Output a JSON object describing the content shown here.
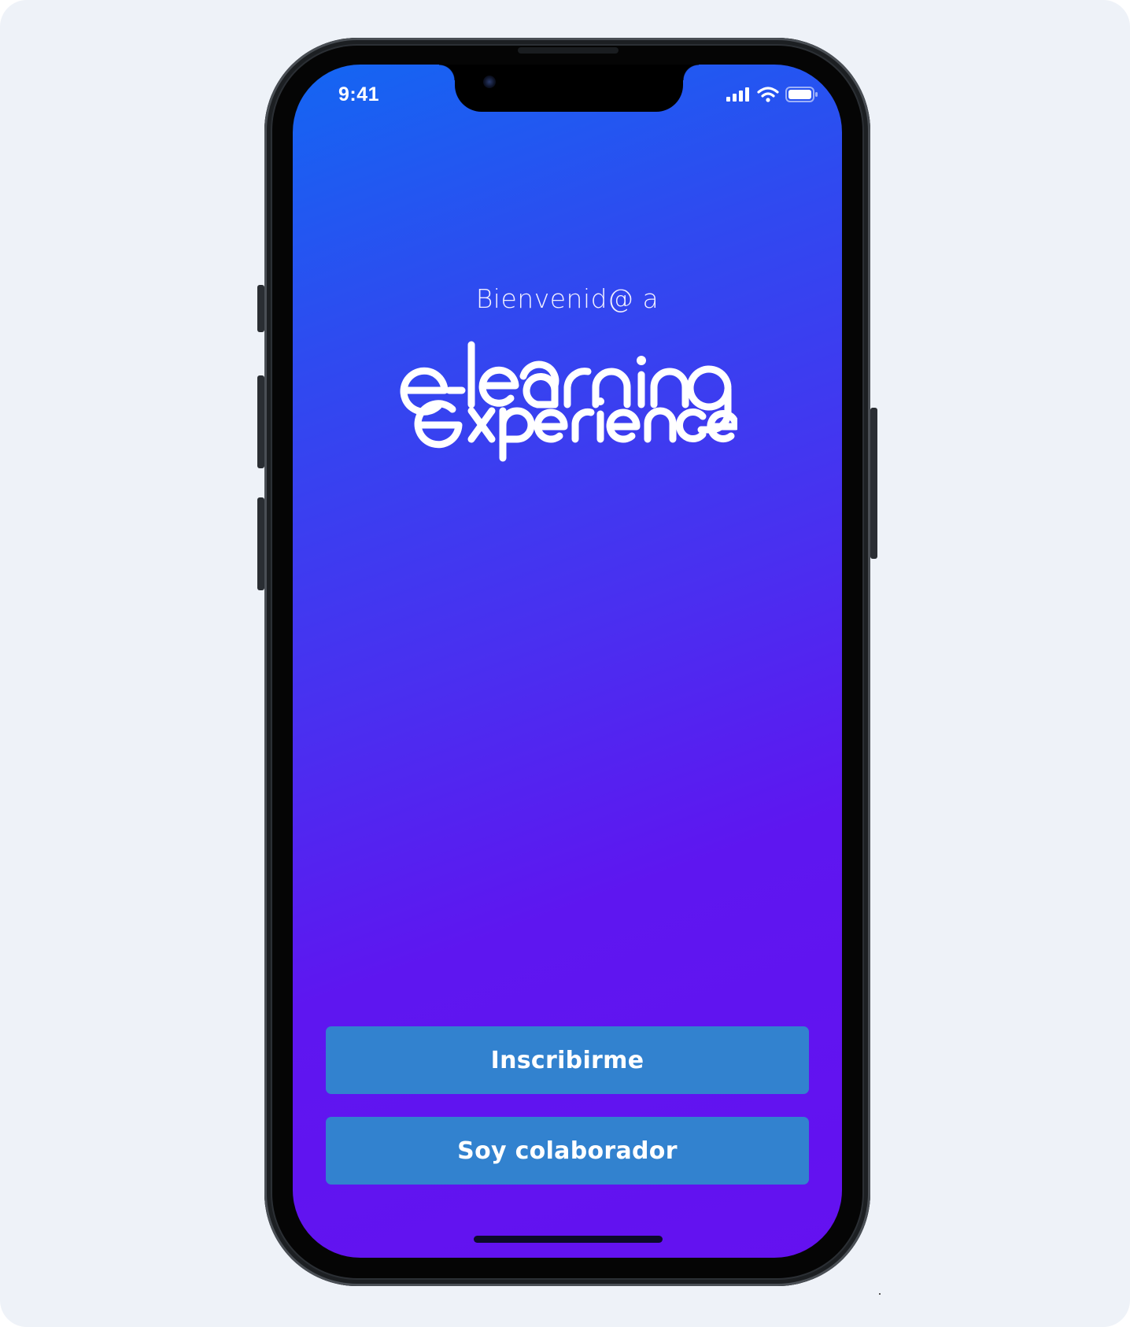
{
  "status_bar": {
    "time": "9:41",
    "icons": [
      "cellular-signal-icon",
      "wifi-icon",
      "battery-icon"
    ]
  },
  "welcome": {
    "text": "Bienvenid@ a"
  },
  "logo": {
    "line1": "e-learning",
    "line2": "experience",
    "color": "#ffffff"
  },
  "buttons": {
    "enroll_label": "Inscribirme",
    "collaborator_label": "Soy colaborador"
  },
  "colors": {
    "background": "#eef2f8",
    "gradient_start": "#1466f2",
    "gradient_end": "#6411f0",
    "button": "#3282cf"
  }
}
